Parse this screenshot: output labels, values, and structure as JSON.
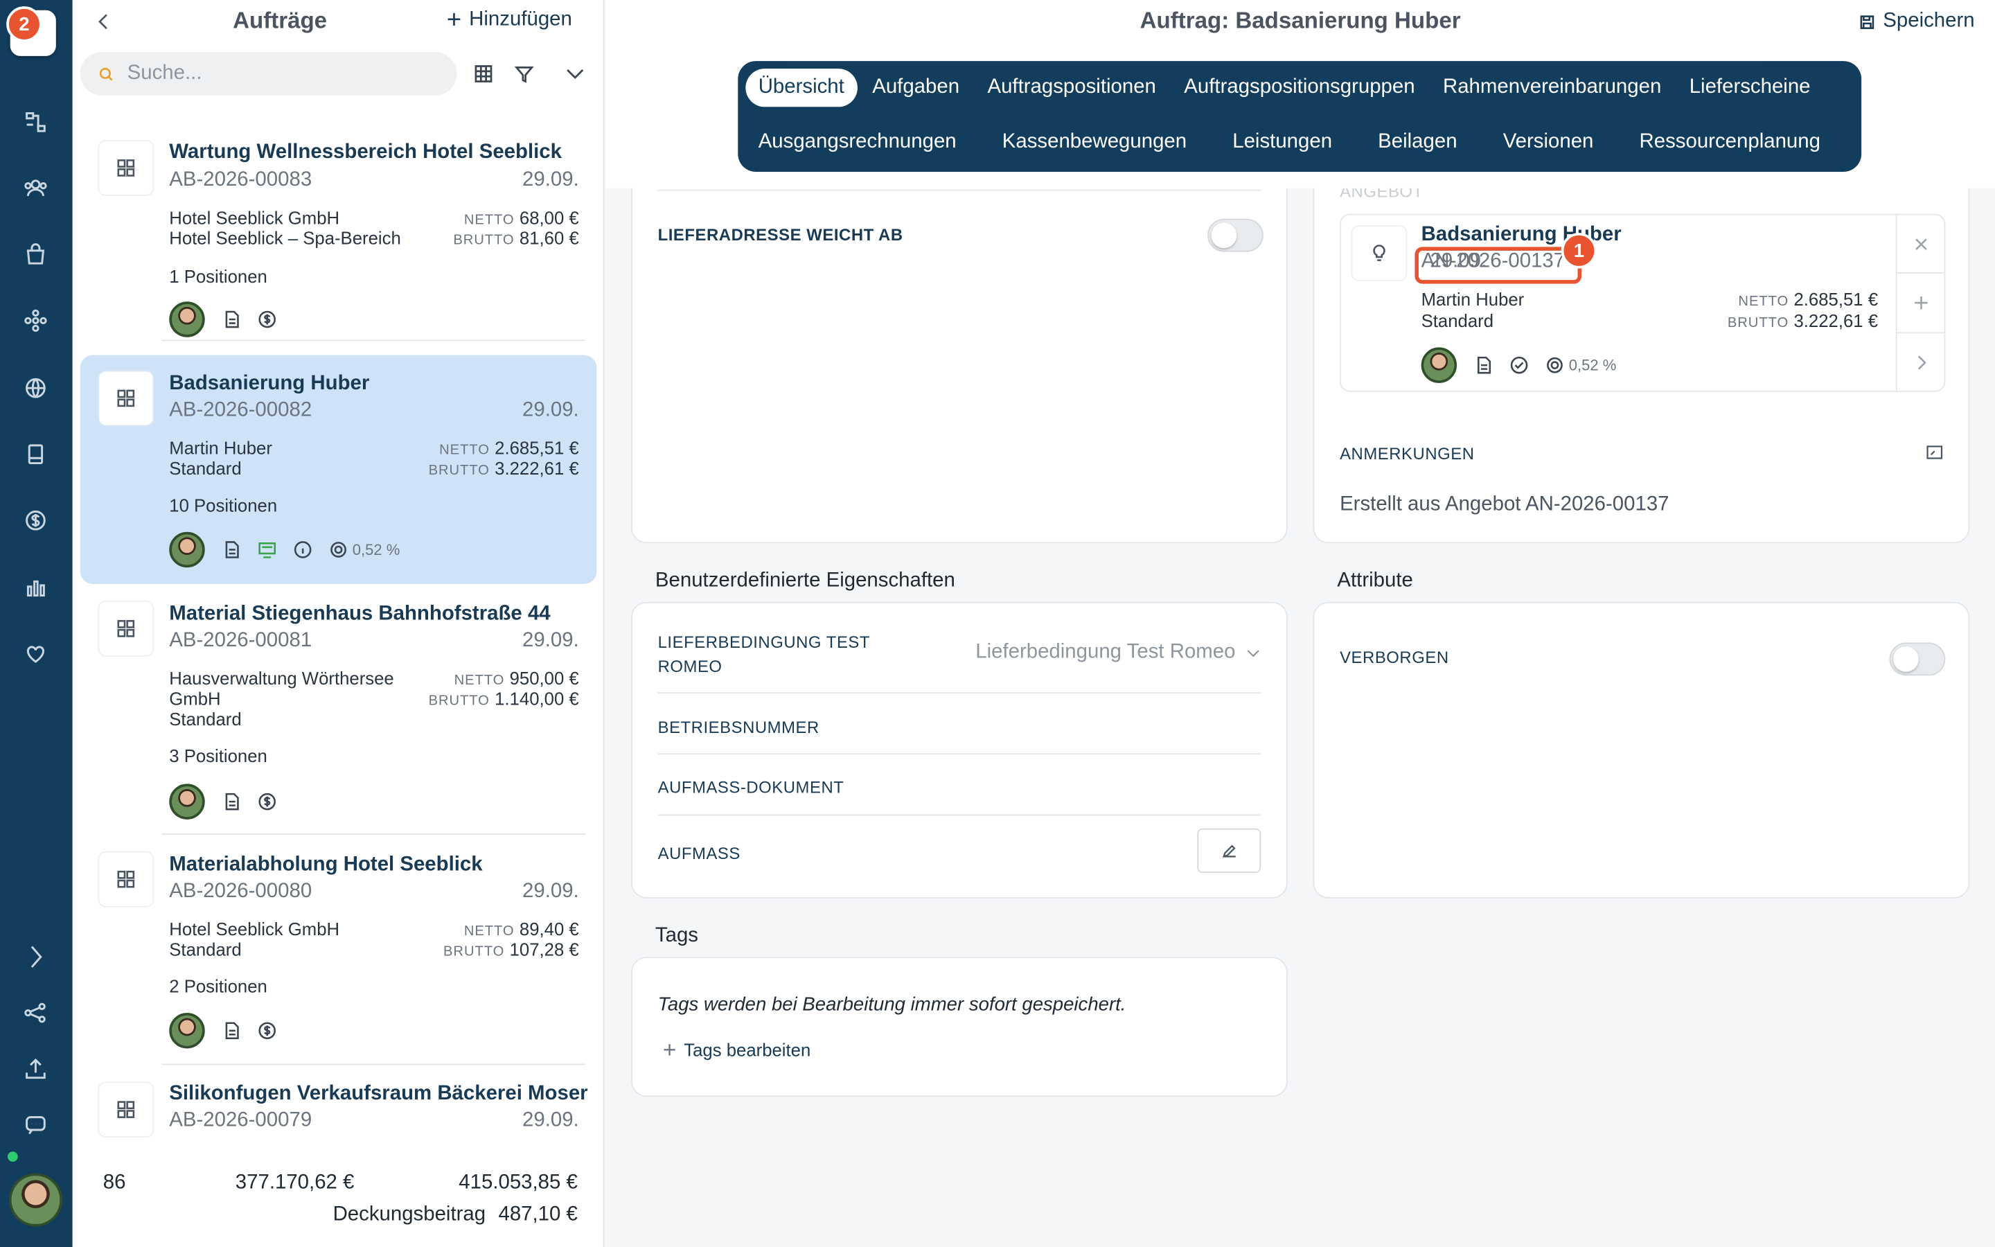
{
  "rail": {
    "notification_count": "2",
    "icons": [
      "chart-flow-icon",
      "users-icon",
      "bag-icon",
      "network-icon",
      "globe-icon",
      "book-icon",
      "dollar-icon",
      "bar-chart-icon",
      "heart-icon"
    ],
    "bottom_icons": [
      "chevron-right-icon",
      "share-icon",
      "upload-icon",
      "chat-icon"
    ]
  },
  "list": {
    "title": "Aufträge",
    "add_label": "Hinzufügen",
    "search_placeholder": "Suche...",
    "items": [
      {
        "title": "Wartung Wellnessbereich Hotel Seeblick",
        "number": "AB-2026-00083",
        "date": "29.09.",
        "customer": "Hotel Seeblick GmbH",
        "sub": "Hotel Seeblick – Spa-Bereich",
        "netto_label": "NETTO",
        "netto": "68,00 €",
        "brutto_label": "BRUTTO",
        "brutto": "81,60 €",
        "positions": "1 Positionen"
      },
      {
        "title": "Badsanierung Huber",
        "number": "AB-2026-00082",
        "date": "29.09.",
        "customer": "Martin Huber",
        "sub": "Standard",
        "netto_label": "NETTO",
        "netto": "2.685,51 €",
        "brutto_label": "BRUTTO",
        "brutto": "3.222,61 €",
        "positions": "10 Positionen",
        "pct": "0,52 %"
      },
      {
        "title": "Material Stiegenhaus Bahnhofstraße 44",
        "number": "AB-2026-00081",
        "date": "29.09.",
        "customer": "Hausverwaltung Wörthersee",
        "customer2": "GmbH",
        "sub": "Standard",
        "netto_label": "NETTO",
        "netto": "950,00 €",
        "brutto_label": "BRUTTO",
        "brutto": "1.140,00 €",
        "positions": "3 Positionen"
      },
      {
        "title": "Materialabholung Hotel Seeblick",
        "number": "AB-2026-00080",
        "date": "29.09.",
        "customer": "Hotel Seeblick GmbH",
        "sub": "Standard",
        "netto_label": "NETTO",
        "netto": "89,40 €",
        "brutto_label": "BRUTTO",
        "brutto": "107,28 €",
        "positions": "2 Positionen"
      },
      {
        "title": "Silikonfugen Verkaufsraum Bäckerei Moser",
        "number": "AB-2026-00079",
        "date": "29.09."
      }
    ],
    "totals": {
      "count": "86",
      "netto": "377.170,62 €",
      "brutto": "415.053,85 €",
      "db_label": "Deckungsbeitrag",
      "db_value": "487,10 €"
    }
  },
  "main": {
    "title": "Auftrag: Badsanierung Huber",
    "save_label": "Speichern",
    "tabs_row1": [
      "Übersicht",
      "Aufgaben",
      "Auftragspositionen",
      "Auftragspositionsgruppen",
      "Rahmenvereinbarungen",
      "Lieferscheine"
    ],
    "tabs_row2": [
      "Ausgangsrechnungen",
      "Kassenbewegungen",
      "Leistungen",
      "Beilagen",
      "Versionen",
      "Ressourcenplanung"
    ],
    "lieferadresse_label": "LIEFERADRESSE WEICHT AB",
    "angebot_label": "ANGEBOT",
    "angebot": {
      "title": "Badsanierung Huber",
      "number": "AN-2026-00137",
      "date": "29.09.",
      "customer": "Martin Huber",
      "sub": "Standard",
      "netto_label": "NETTO",
      "netto": "2.685,51 €",
      "brutto_label": "BRUTTO",
      "brutto": "3.222,61 €",
      "pct": "0,52 %",
      "step_badge": "1"
    },
    "anmerkungen_label": "ANMERKUNGEN",
    "anmerkungen_text": "Erstellt aus Angebot AN-2026-00137",
    "custom_props_title": "Benutzerdefinierte Eigenschaften",
    "props": {
      "lieferbedingung_label_1": "LIEFERBEDINGUNG TEST",
      "lieferbedingung_label_2": "ROMEO",
      "lieferbedingung_value": "Lieferbedingung Test Romeo",
      "betriebsnummer_label": "BETRIEBSNUMMER",
      "aufmass_dokument_label": "AUFMASS-DOKUMENT",
      "aufmass_label": "AUFMASS"
    },
    "attribute_title": "Attribute",
    "verborgen_label": "VERBORGEN",
    "tags_title": "Tags",
    "tags_note": "Tags werden bei Bearbeitung immer sofort gespeichert.",
    "tags_edit": "Tags bearbeiten"
  },
  "colors": {
    "rail": "#123d5c",
    "selected": "#cfe3f8",
    "accent": "#e8542f",
    "title": "#193a55"
  }
}
